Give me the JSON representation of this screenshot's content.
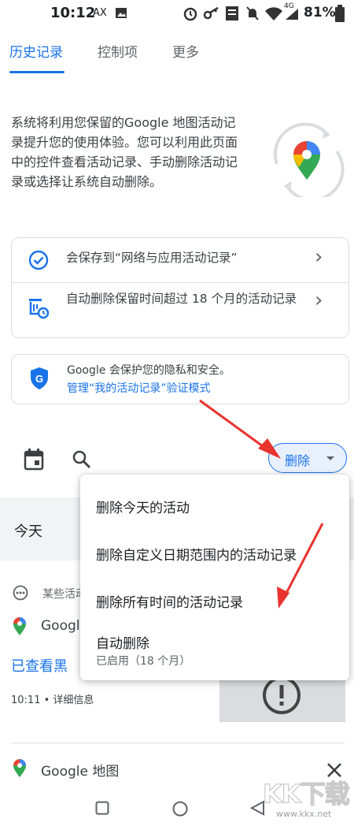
{
  "status_bar": {
    "time": "10:12",
    "carrier_tag": "AX",
    "network": "4G",
    "battery": "81%"
  },
  "tabs": [
    {
      "label": "历史记录",
      "active": true
    },
    {
      "label": "控制项",
      "active": false
    },
    {
      "label": "更多",
      "active": false
    }
  ],
  "intro": "系统将利用您保留的Google 地图活动记录提升您的使用体验。您可以利用此页面中的控件查看活动记录、手动删除活动记录或选择让系统自动删除。",
  "settings_card": {
    "saving": "会保存到“网络与应用活动记录”",
    "auto_delete": "自动删除保留时间超过 18 个月的活动记录"
  },
  "privacy_card": {
    "text": "Google 会保护您的隐私和安全。",
    "link": "管理“我的活动记录”验证模式"
  },
  "toolbar": {
    "delete_label": "删除"
  },
  "list": {
    "section_today": "今天",
    "row1_label": "某些活动",
    "row2_app": "Google",
    "view_link": "已查看黑",
    "row_time": "10:11 • 详细信息",
    "bottom_app": "Google 地图"
  },
  "delete_menu": {
    "today": "删除今天的活动",
    "custom_range": "删除自定义日期范围内的活动记录",
    "all_time": "删除所有时间的活动记录",
    "auto_delete": "自动删除",
    "auto_delete_sub": "已启用（18 个月）"
  },
  "watermark": {
    "brand": "KK下载",
    "url": "www.kkx.net"
  },
  "colors": {
    "accent": "#1a73e8",
    "arrow": "#e8332e"
  },
  "icons": [
    "check-circle-icon",
    "auto-delete-icon",
    "shield-icon",
    "calendar-icon",
    "search-icon",
    "maps-pin-icon"
  ]
}
